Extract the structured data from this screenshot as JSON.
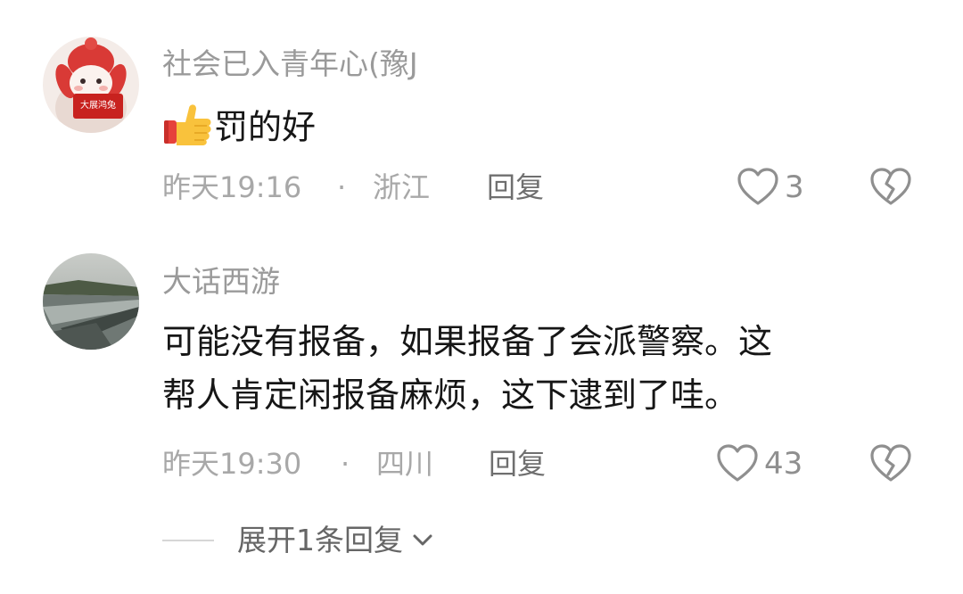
{
  "comments": [
    {
      "username": "社会已入青年心(豫J",
      "text": "罚的好",
      "emoji_icon": "thumbs-up-icon",
      "time": "昨天19:16",
      "separator": "·",
      "location": "浙江",
      "reply_label": "回复",
      "like_count": "3",
      "avatar_badge": "大展鸿兔"
    },
    {
      "username": "大话西游",
      "text_lines": [
        "可能没有报备，如果报备了会派警察。这",
        "帮人肯定闲报备麻烦，这下逮到了哇。"
      ],
      "time": "昨天19:30",
      "separator": "·",
      "location": "四川",
      "reply_label": "回复",
      "like_count": "43"
    }
  ],
  "expand_replies": {
    "label": "展开1条回复"
  },
  "colors": {
    "username": "#9a9a9a",
    "body_text": "#161616",
    "meta": "#a8a8a8",
    "reply": "#6f6f6f",
    "icon": "#8f8f8f"
  }
}
